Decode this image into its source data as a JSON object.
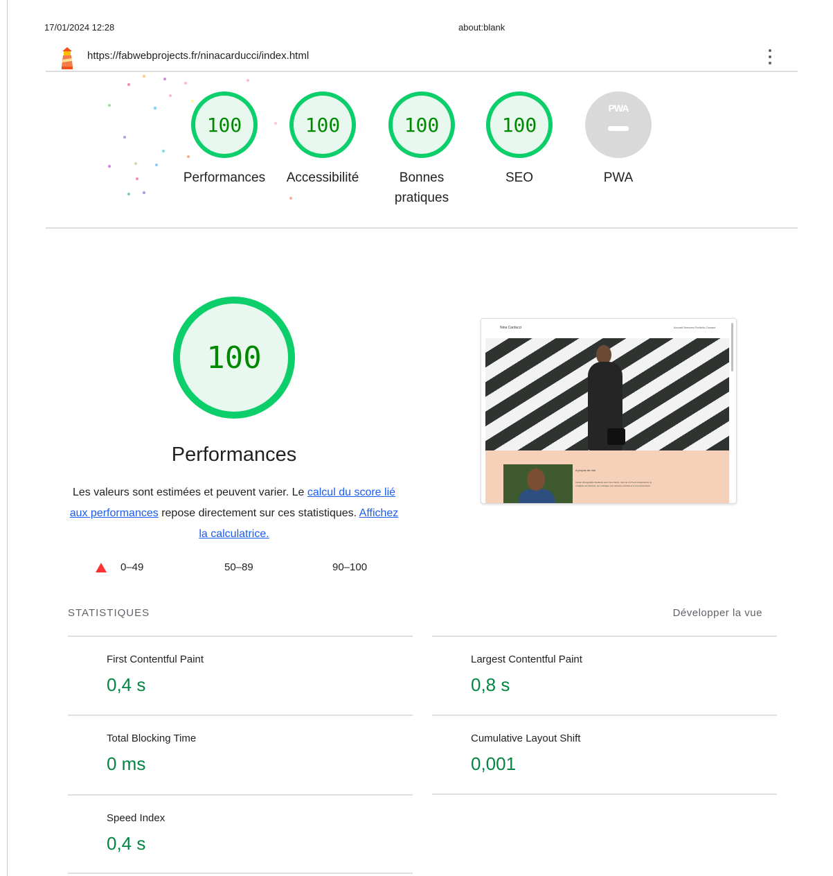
{
  "print_header": {
    "date": "17/01/2024 12:28",
    "title": "about:blank"
  },
  "topbar": {
    "url": "https://fabwebprojects.fr/ninacarducci/index.html",
    "logo_icon": "lighthouse-icon",
    "menu_icon": "kebab-menu-icon"
  },
  "gauges": [
    {
      "score": "100",
      "label": "Performances"
    },
    {
      "score": "100",
      "label": "Accessibilité"
    },
    {
      "score": "100",
      "label": "Bonnes pratiques"
    },
    {
      "score": "100",
      "label": "SEO"
    },
    {
      "badge": "PWA",
      "label": "PWA"
    }
  ],
  "performance": {
    "score": "100",
    "title": "Performances",
    "desc_before": "Les valeurs sont estimées et peuvent varier. Le ",
    "desc_link1": "calcul du score lié aux performances",
    "desc_middle": " repose directement sur ces statistiques. ",
    "desc_link2": "Affichez la calculatrice."
  },
  "legend": {
    "fail": "0–49",
    "average": "50–89",
    "pass": "90–100"
  },
  "screenshot": {
    "brand": "Nina Carducci",
    "nav": "Accueil  Services  Portfolio  Contact",
    "about_title": "A propos de moi",
    "about_text": "Ancien photographe freelance avec mes clients. Comme 4 à 5 ans d'expérience, je m'adapte aux besoins, aux mariages, aux séances portraits et à vos événements."
  },
  "statistics": {
    "heading": "STATISTIQUES",
    "expand_label": "Développer la vue",
    "metrics": [
      {
        "label": "First Contentful Paint",
        "value": "0,4 s"
      },
      {
        "label": "Largest Contentful Paint",
        "value": "0,8 s"
      },
      {
        "label": "Total Blocking Time",
        "value": "0 ms"
      },
      {
        "label": "Cumulative Layout Shift",
        "value": "0,001"
      },
      {
        "label": "Speed Index",
        "value": "0,4 s"
      }
    ]
  },
  "colors": {
    "pass": "#0cce6b",
    "pass_text": "#008800",
    "pass_fill": "#e9f8ef",
    "fail": "#ff3333",
    "link": "#1a5cf0",
    "metric_value": "#018642"
  }
}
